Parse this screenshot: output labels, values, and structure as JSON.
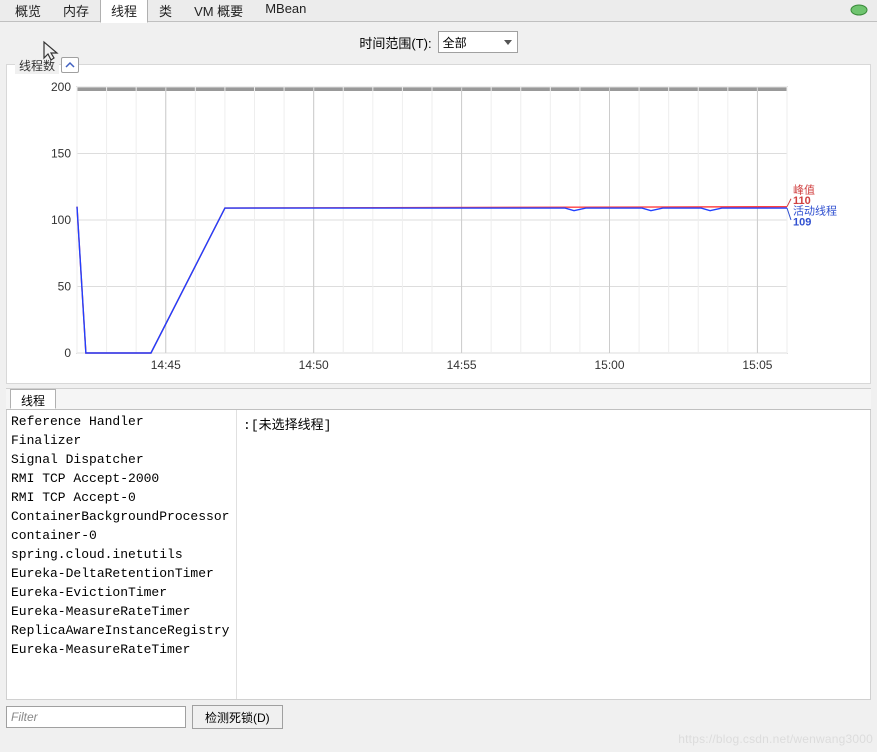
{
  "tabs": [
    "概览",
    "内存",
    "线程",
    "类",
    "VM 概要",
    "MBean"
  ],
  "active_tab_index": 2,
  "time_range": {
    "label": "时间范围(T):",
    "selected": "全部"
  },
  "chart": {
    "fieldset_label": "线程数",
    "collapse_icon": "chevron-up"
  },
  "chart_data": {
    "type": "line",
    "xlabel": "",
    "ylabel": "",
    "ylim": [
      0,
      200
    ],
    "y_ticks": [
      0,
      50,
      100,
      150,
      200
    ],
    "x_ticks": [
      "14:45",
      "14:50",
      "14:55",
      "15:00",
      "15:05"
    ],
    "x_range_minutes": [
      42,
      66
    ],
    "series": [
      {
        "name": "峰值",
        "color": "#ff4040",
        "current": 110,
        "points": [
          [
            42.0,
            110
          ],
          [
            42.3,
            0
          ],
          [
            44.5,
            0
          ],
          [
            47.0,
            109
          ],
          [
            66.0,
            110
          ]
        ]
      },
      {
        "name": "活动线程",
        "color": "#2040ff",
        "current": 109,
        "points": [
          [
            42.0,
            110
          ],
          [
            42.3,
            0
          ],
          [
            44.5,
            0
          ],
          [
            47.0,
            109
          ],
          [
            58.5,
            109
          ],
          [
            58.8,
            107
          ],
          [
            59.2,
            109
          ],
          [
            61.1,
            109
          ],
          [
            61.4,
            107
          ],
          [
            61.8,
            109
          ],
          [
            63.1,
            109
          ],
          [
            63.4,
            107
          ],
          [
            63.8,
            109
          ],
          [
            66.0,
            109
          ]
        ]
      }
    ],
    "legend": {
      "peak_label": "峰值",
      "peak_value": "110",
      "active_label": "活动线程",
      "active_value": "109"
    }
  },
  "threads_section": {
    "tab_label": "线程",
    "detail_placeholder": "[未选择线程]",
    "filter_placeholder": "Filter",
    "detect_button": "检测死锁(D)",
    "threads": [
      "Reference Handler",
      "Finalizer",
      "Signal Dispatcher",
      "RMI TCP Accept-2000",
      "RMI TCP Accept-0",
      "ContainerBackgroundProcessor",
      "container-0",
      "spring.cloud.inetutils",
      "Eureka-DeltaRetentionTimer",
      "Eureka-EvictionTimer",
      "Eureka-MeasureRateTimer",
      "ReplicaAwareInstanceRegistry",
      "Eureka-MeasureRateTimer"
    ]
  },
  "watermark": "https://blog.csdn.net/wenwang3000"
}
